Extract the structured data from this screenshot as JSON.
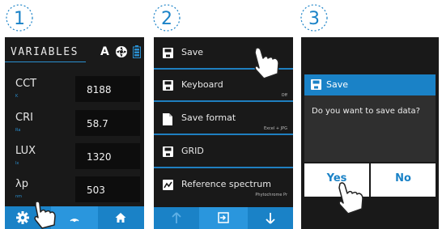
{
  "steps": [
    "1",
    "2",
    "3"
  ],
  "colors": {
    "accent": "#1a82c7",
    "panel": "#191919",
    "label_blue": "#2a8fd0"
  },
  "panel1": {
    "header_title": "VARIABLES",
    "header_mode": "A",
    "icons": [
      "aperture-icon",
      "battery-icon"
    ],
    "rows": [
      {
        "label": "CCT",
        "sub": "K",
        "value": "8188"
      },
      {
        "label": "CRI",
        "sub": "Ra",
        "value": "58.7"
      },
      {
        "label": "LUX",
        "sub": "lx",
        "value": "1320"
      },
      {
        "label": "λp",
        "sub": "nm",
        "value": "503"
      }
    ],
    "bottom_tabs": [
      "gear-icon",
      "wave-icon",
      "home-icon"
    ]
  },
  "panel2": {
    "items": [
      {
        "label": "Save",
        "sub": "",
        "icon": "floppy-icon"
      },
      {
        "label": "Keyboard",
        "sub": "Off",
        "icon": "floppy-icon"
      },
      {
        "label": "Save format",
        "sub": "Excel + JPG",
        "icon": "file-icon"
      },
      {
        "label": "GRID",
        "sub": "",
        "icon": "floppy-icon"
      },
      {
        "label": "Reference spectrum",
        "sub": "Phytochrome Pr",
        "icon": "chart-icon"
      }
    ],
    "bottom_buttons": [
      "arrow-up-icon",
      "enter-icon",
      "arrow-down-icon"
    ]
  },
  "panel3": {
    "dialog_title": "Save",
    "message": "Do you want to save data?",
    "yes_label": "Yes",
    "no_label": "No"
  }
}
